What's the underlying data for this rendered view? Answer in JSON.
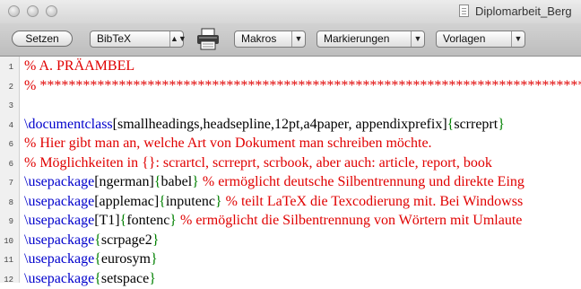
{
  "window": {
    "title": "Diplomarbeit_Berg"
  },
  "toolbar": {
    "typeset_label": "Setzen",
    "format_value": "BibTeX",
    "format_arrow": "▲▼",
    "makros_label": "Makros",
    "markierungen_label": "Markierungen",
    "vorlagen_label": "Vorlagen",
    "menu_arrow": "▼"
  },
  "lines": [
    {
      "num": "1",
      "segments": [
        {
          "t": "% A. PRÄAMBEL",
          "c": "red"
        }
      ]
    },
    {
      "num": "2",
      "segments": [
        {
          "t": "% *****************************************************************************",
          "c": "red"
        }
      ]
    },
    {
      "num": "3",
      "segments": []
    },
    {
      "num": "4",
      "segments": [
        {
          "t": "\\documentclass",
          "c": "blue"
        },
        {
          "t": "[smallheadings,headsepline,12pt,a4paper, appendixprefix]",
          "c": "black"
        },
        {
          "t": "{",
          "c": "green"
        },
        {
          "t": "scrreprt",
          "c": "black"
        },
        {
          "t": "}",
          "c": "green"
        }
      ]
    },
    {
      "num": "6",
      "segments": [
        {
          "t": "% Hier gibt man an, welche Art von Dokument man schreiben möchte.",
          "c": "red"
        }
      ]
    },
    {
      "num": "6",
      "segments": [
        {
          "t": "% Möglichkeiten in {}: scrartcl, scrreprt, scrbook, aber auch: article, report, book",
          "c": "red"
        }
      ]
    },
    {
      "num": "7",
      "segments": [
        {
          "t": "\\usepackage",
          "c": "blue"
        },
        {
          "t": "[ngerman]",
          "c": "black"
        },
        {
          "t": "{",
          "c": "green"
        },
        {
          "t": "babel",
          "c": "black"
        },
        {
          "t": "}",
          "c": "green"
        },
        {
          "t": " % ermöglicht deutsche Silbentrennung und direkte Eing",
          "c": "red"
        }
      ]
    },
    {
      "num": "8",
      "segments": [
        {
          "t": "\\usepackage",
          "c": "blue"
        },
        {
          "t": "[applemac]",
          "c": "black"
        },
        {
          "t": "{",
          "c": "green"
        },
        {
          "t": "inputenc",
          "c": "black"
        },
        {
          "t": "}",
          "c": "green"
        },
        {
          "t": " % teilt LaTeX die Texcodierung mit. Bei Windowss",
          "c": "red"
        }
      ]
    },
    {
      "num": "9",
      "segments": [
        {
          "t": "\\usepackage",
          "c": "blue"
        },
        {
          "t": "[T1]",
          "c": "black"
        },
        {
          "t": "{",
          "c": "green"
        },
        {
          "t": "fontenc",
          "c": "black"
        },
        {
          "t": "}",
          "c": "green"
        },
        {
          "t": " % ermöglicht die Silbentrennung von Wörtern mit Umlaute",
          "c": "red"
        }
      ]
    },
    {
      "num": "10",
      "segments": [
        {
          "t": "\\usepackage",
          "c": "blue"
        },
        {
          "t": "{",
          "c": "green"
        },
        {
          "t": "scrpage2",
          "c": "black"
        },
        {
          "t": "}",
          "c": "green"
        }
      ]
    },
    {
      "num": "11",
      "segments": [
        {
          "t": "\\usepackage",
          "c": "blue"
        },
        {
          "t": "{",
          "c": "green"
        },
        {
          "t": "eurosym",
          "c": "black"
        },
        {
          "t": "}",
          "c": "green"
        }
      ]
    },
    {
      "num": "12",
      "segments": [
        {
          "t": "\\usepackage",
          "c": "blue"
        },
        {
          "t": "{",
          "c": "green"
        },
        {
          "t": "setspace",
          "c": "black"
        },
        {
          "t": "}",
          "c": "green"
        }
      ]
    }
  ],
  "colors": {
    "red": "#e00000",
    "blue": "#0000cc",
    "green": "#008000",
    "black": "#000000"
  },
  "icons": {
    "print": "printer-icon",
    "document": "document-icon"
  }
}
